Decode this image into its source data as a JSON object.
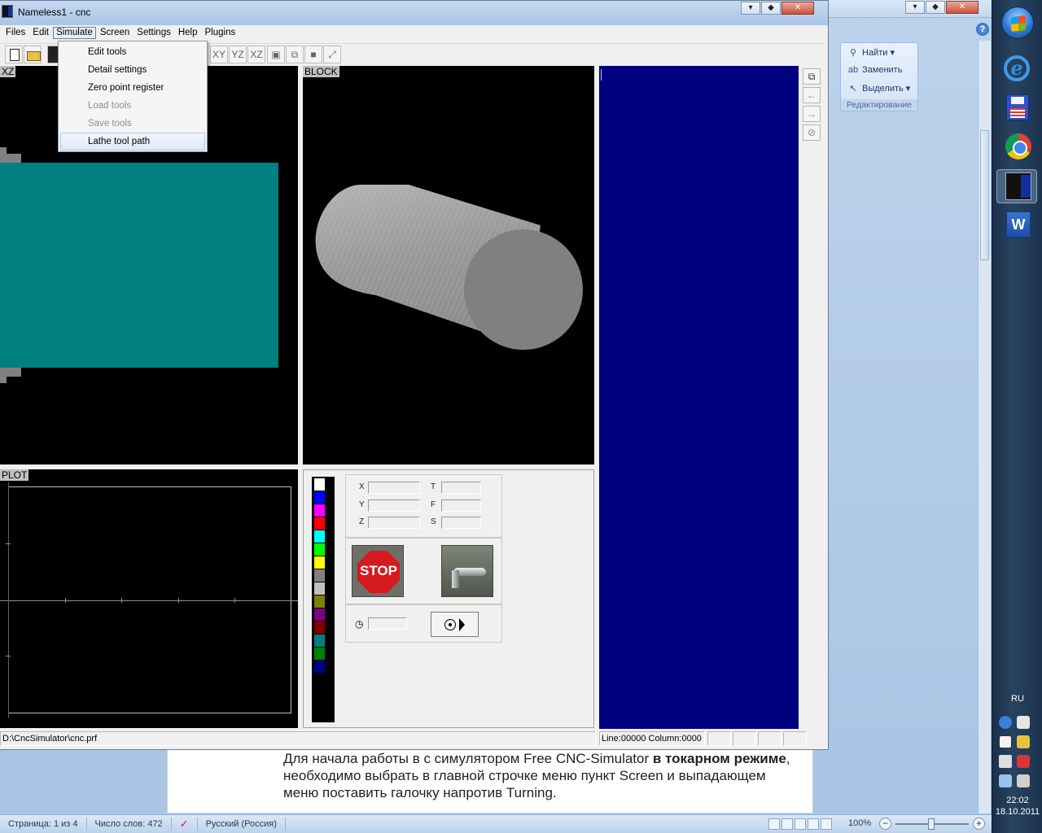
{
  "cnc": {
    "title": "Nameless1 - cnc",
    "menu": [
      "Files",
      "Edit",
      "Simulate",
      "Screen",
      "Settings",
      "Help",
      "Plugins"
    ],
    "simulate_menu": [
      {
        "label": "Edit tools",
        "enabled": true
      },
      {
        "label": "Detail settings",
        "enabled": true
      },
      {
        "label": "Zero point register",
        "enabled": true
      },
      {
        "label": "Load tools",
        "enabled": false
      },
      {
        "label": "Save tools",
        "enabled": false
      },
      {
        "label": "Lathe tool path",
        "enabled": true,
        "highlighted": true
      }
    ],
    "toolbar_view_labels": [
      "XY",
      "YZ",
      "XZ"
    ],
    "panels": {
      "xz": "XZ",
      "block": "BLOCK",
      "plot": "PLOT"
    },
    "coords": {
      "labels": [
        "X",
        "Y",
        "Z",
        "T",
        "F",
        "S"
      ]
    },
    "stop_label": "STOP",
    "palette": [
      "#ffffff",
      "#0000ff",
      "#ff00ff",
      "#ff0000",
      "#00ffff",
      "#00ff00",
      "#ffff00",
      "#808080",
      "#c0c0c0",
      "#808000",
      "#800080",
      "#800000",
      "#008080",
      "#008000",
      "#000080"
    ],
    "status": {
      "path": "D:\\CncSimulator\\cnc.prf",
      "position": "Line:00000 Column:0000"
    },
    "window_buttons": [
      "▾",
      "◆",
      "✕"
    ]
  },
  "word": {
    "window_buttons": [
      "▾",
      "◆",
      "✕"
    ],
    "help_icon": "?",
    "ribbon": {
      "items": [
        "Найти ▾",
        "Заменить",
        "Выделить ▾"
      ],
      "group_caption": "Редактирование"
    },
    "document": {
      "line1_a": "Для начала работы в с симулятором Free CNC-Simulator ",
      "line1_b": "в токарном",
      "line2_a": "режиме",
      "line2_b": ", необходимо выбрать в главной строчке меню пункт Screen     и",
      "line3": "выпадающем меню поставить галочку напротив Turning."
    },
    "status": {
      "page": "Страница: 1 из 4",
      "words": "Число слов: 472",
      "language": "Русский (Россия)",
      "zoom": "100%",
      "zoom_minus": "−",
      "zoom_plus": "+"
    }
  },
  "taskbar": {
    "lang": "RU",
    "time": "22:02",
    "date": "18.10.2011",
    "word_icon_letter": "W",
    "ie_icon_letter": "e"
  }
}
